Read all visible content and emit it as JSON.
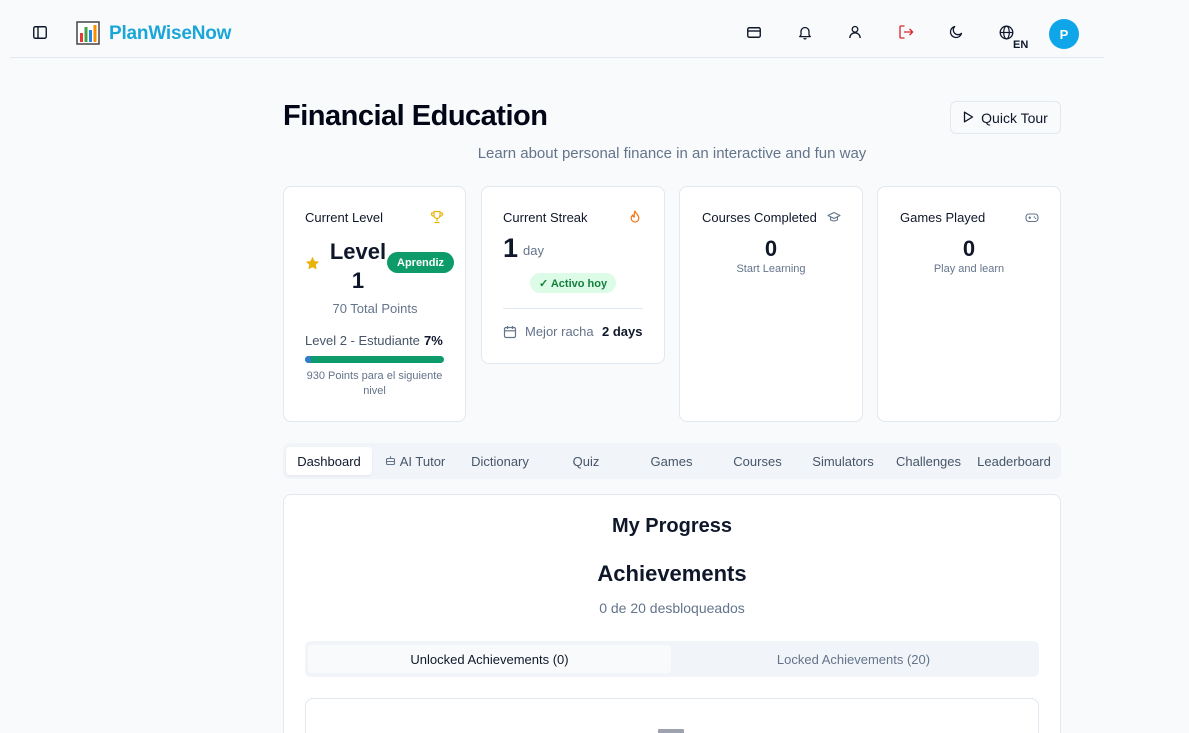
{
  "header": {
    "brand": "PlanWiseNow",
    "language": "EN",
    "avatar_initial": "P",
    "icons": [
      "sidebar-toggle-icon",
      "chart-logo-icon",
      "credit-card-icon",
      "bell-icon",
      "user-icon",
      "logout-icon",
      "moon-icon",
      "globe-icon"
    ]
  },
  "page": {
    "title": "Financial Education",
    "subtitle": "Learn about personal finance in an interactive and fun way",
    "tour_button": "Quick Tour"
  },
  "stats": {
    "level": {
      "title": "Current Level",
      "value": "Level 1",
      "badge": "Aprendiz",
      "points": "70 Total Points",
      "next_label": "Level 2 - Estudiante",
      "percent": "7%",
      "progress_fraction": 0.07,
      "remaining": "930 Points para el siguiente nivel"
    },
    "streak": {
      "title": "Current Streak",
      "value": "1",
      "unit": "day",
      "badge": "✓ Activo hoy",
      "best_label": "Mejor racha",
      "best_value": "2 days"
    },
    "courses": {
      "title": "Courses Completed",
      "value": "0",
      "sub": "Start Learning"
    },
    "games": {
      "title": "Games Played",
      "value": "0",
      "sub": "Play and learn"
    }
  },
  "tabs": [
    "Dashboard",
    "AI Tutor",
    "Dictionary",
    "Quiz",
    "Games",
    "Courses",
    "Simulators",
    "Challenges",
    "Leaderboard"
  ],
  "active_tab": "Dashboard",
  "progress": {
    "title": "My Progress",
    "achievements_title": "Achievements",
    "achievements_sub": "0 de 20 desbloqueados",
    "subtabs": [
      "Unlocked Achievements (0)",
      "Locked Achievements (20)"
    ]
  },
  "colors": {
    "brand": "#1aa6d8",
    "accent_green": "#0e9b6a",
    "avatar": "#0ea5e9",
    "logout": "#dc2626"
  }
}
